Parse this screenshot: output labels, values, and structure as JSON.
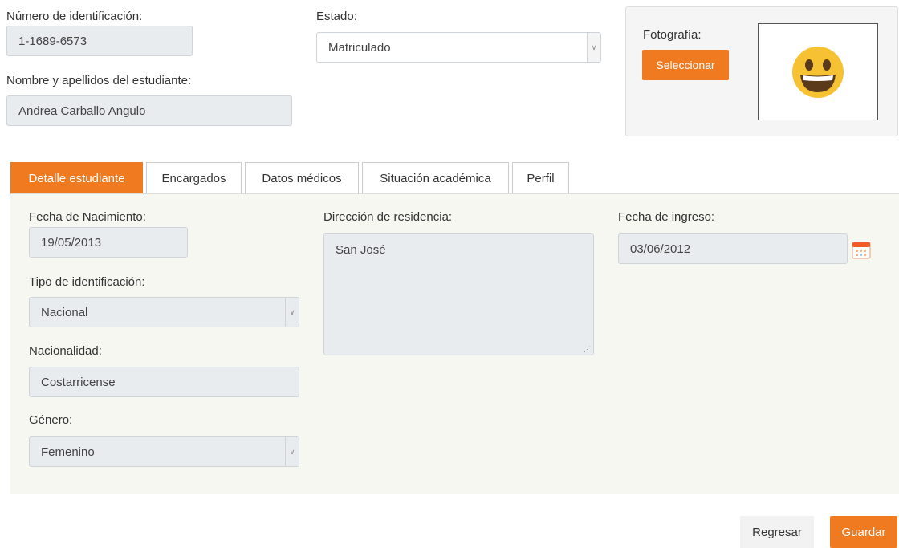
{
  "header": {
    "id_label": "Número de identificación:",
    "id_value": "1-1689-6573",
    "name_label": "Nombre y apellidos del estudiante:",
    "name_value": "Andrea Carballo Angulo",
    "estado_label": "Estado:",
    "estado_value": "Matriculado",
    "photo_label": "Fotografía:",
    "select_button": "Seleccionar",
    "photo_icon": "smiley-face-icon"
  },
  "tabs": [
    {
      "label": "Detalle estudiante",
      "active": true
    },
    {
      "label": "Encargados",
      "active": false
    },
    {
      "label": "Datos médicos",
      "active": false
    },
    {
      "label": "Situación académica",
      "active": false
    },
    {
      "label": "Perfil",
      "active": false
    }
  ],
  "detail": {
    "birth_label": "Fecha de Nacimiento:",
    "birth_value": "19/05/2013",
    "id_type_label": "Tipo de identificación:",
    "id_type_value": "Nacional",
    "nationality_label": "Nacionalidad:",
    "nationality_value": "Costarricense",
    "gender_label": "Género:",
    "gender_value": "Femenino",
    "address_label": "Dirección de residencia:",
    "address_value": "San José",
    "entry_label": "Fecha de ingreso:",
    "entry_value": "03/06/2012",
    "calendar_icon": "calendar-icon"
  },
  "footer": {
    "back_button": "Regresar",
    "save_button": "Guardar"
  },
  "colors": {
    "accent": "#f07a20",
    "readonly_bg": "#e9ecef",
    "panel_bg": "#f7f7f2"
  }
}
